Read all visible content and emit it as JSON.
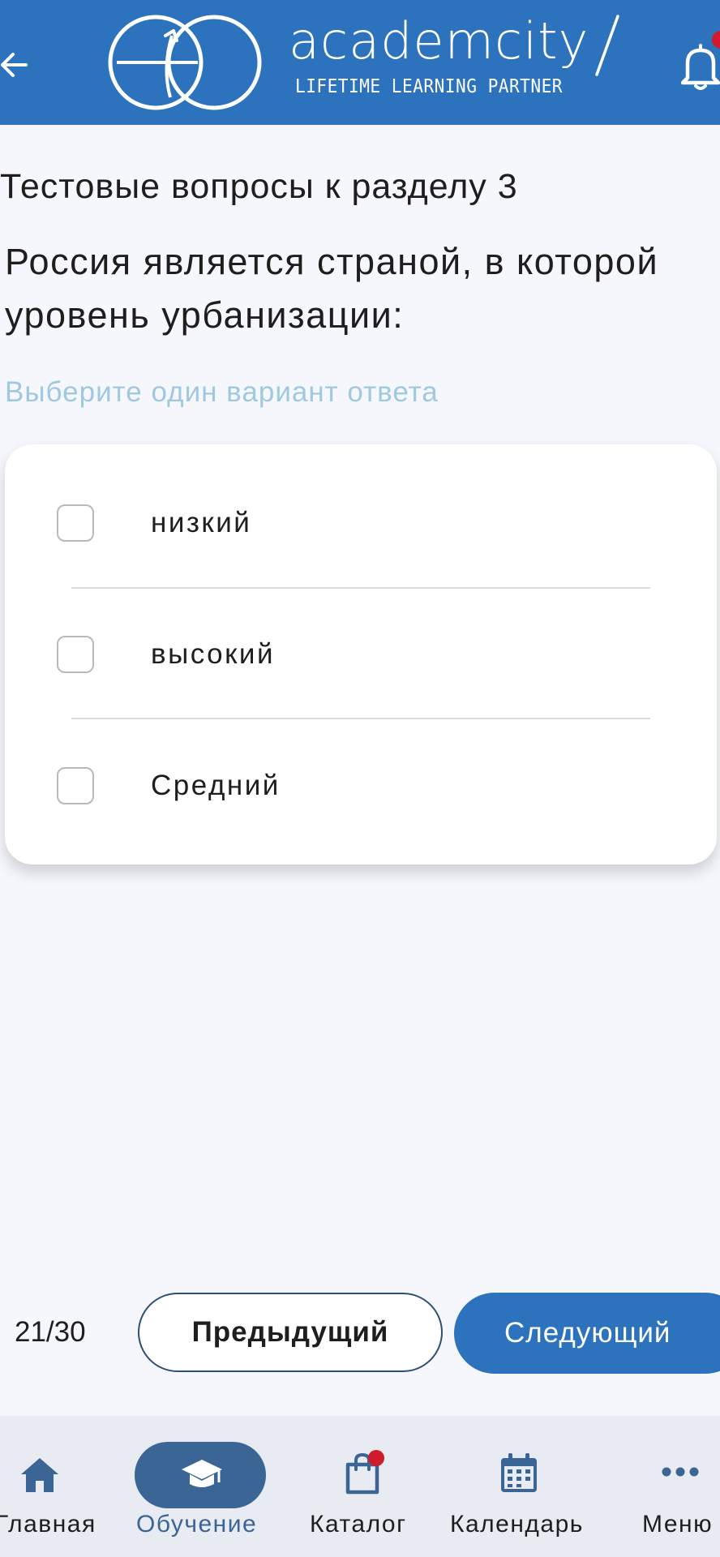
{
  "header": {
    "brand_name": "academcity",
    "tagline": "LIFETIME LEARNING PARTNER",
    "icons": [
      "arrow-left-icon",
      "academcity-logo",
      "bell-icon"
    ],
    "accent_color": "#2c72bd"
  },
  "quiz": {
    "section_title": "Тестовые вопросы к разделу 3",
    "question": "Россия является страной, в которой уровень урбанизации:",
    "hint": "Выберите один вариант ответа",
    "answers": [
      {
        "label": "низкий",
        "checked": false
      },
      {
        "label": "высокий",
        "checked": false
      },
      {
        "label": "Средний",
        "checked": false
      }
    ]
  },
  "pager": {
    "counter": "21/30",
    "prev_label": "Предыдущий",
    "next_label": "Следующий"
  },
  "bottom_nav": {
    "active": "Обучение",
    "items": [
      {
        "label": "Главная",
        "icon": "home-icon"
      },
      {
        "label": "Обучение",
        "icon": "graduation-cap-icon"
      },
      {
        "label": "Каталог",
        "icon": "shopping-bag-icon"
      },
      {
        "label": "Календарь",
        "icon": "calendar-icon"
      },
      {
        "label": "Меню",
        "icon": "more-dots-icon"
      }
    ]
  }
}
